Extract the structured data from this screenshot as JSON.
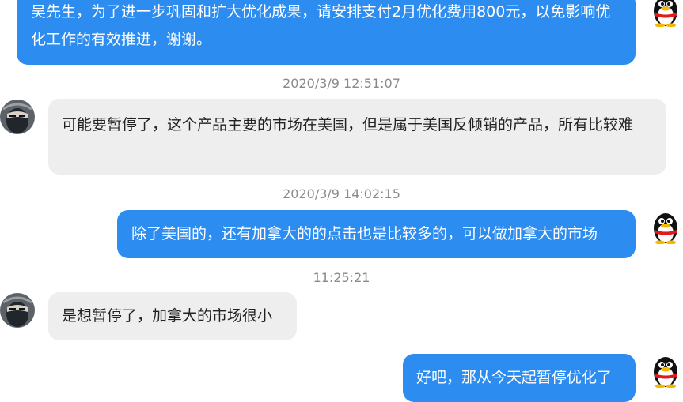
{
  "colors": {
    "outgoing_bubble": "#2d8cf0",
    "incoming_bubble": "#eeeeee",
    "timestamp_text": "#8a8a8a"
  },
  "messages": [
    {
      "side": "outgoing",
      "text": "吴先生，为了进一步巩固和扩大优化成果，请安排支付2月优化费用800元，以免影响优化工作的有效推进，谢谢。",
      "avatar_icon": "penguin-avatar-icon"
    },
    {
      "timestamp": "2020/3/9 12:51:07"
    },
    {
      "side": "incoming",
      "text": "可能要暂停了，这个产品主要的市场在美国，但是属于美国反倾销的产品，所有比较难",
      "avatar_icon": "masked-person-avatar-icon"
    },
    {
      "timestamp": "2020/3/9 14:02:15"
    },
    {
      "side": "outgoing",
      "text": "除了美国的，还有加拿大的的点击也是比较多的，可以做加拿大的市场",
      "avatar_icon": "penguin-avatar-icon"
    },
    {
      "timestamp": "11:25:21"
    },
    {
      "side": "incoming",
      "text": "是想暂停了，加拿大的市场很小",
      "avatar_icon": "masked-person-avatar-icon"
    },
    {
      "side": "outgoing",
      "text": "好吧，那从今天起暂停优化了",
      "avatar_icon": "penguin-avatar-icon"
    }
  ]
}
